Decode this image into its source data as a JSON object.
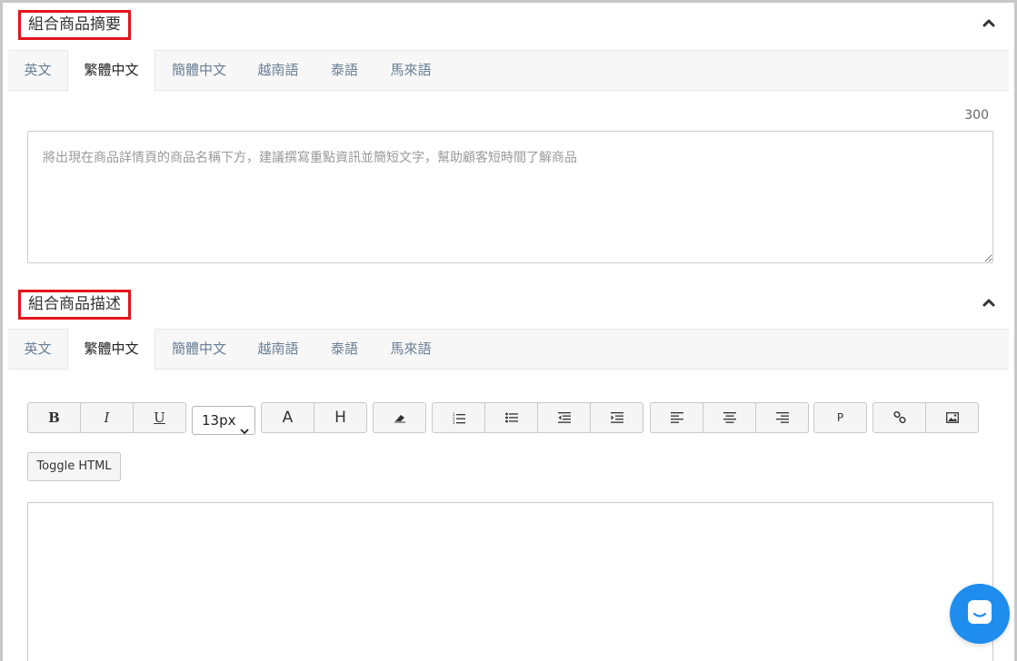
{
  "summary": {
    "title": "組合商品摘要",
    "tabs": [
      {
        "label": "英文"
      },
      {
        "label": "繁體中文"
      },
      {
        "label": "簡體中文"
      },
      {
        "label": "越南語"
      },
      {
        "label": "泰語"
      },
      {
        "label": "馬來語"
      }
    ],
    "active_tab": "繁體中文",
    "char_limit": "300",
    "placeholder": "將出現在商品詳情頁的商品名稱下方，建議撰寫重點資訊並簡短文字，幫助顧客短時間了解商品",
    "value": ""
  },
  "description": {
    "title": "組合商品描述",
    "tabs": [
      {
        "label": "英文"
      },
      {
        "label": "繁體中文"
      },
      {
        "label": "簡體中文"
      },
      {
        "label": "越南語"
      },
      {
        "label": "泰語"
      },
      {
        "label": "馬來語"
      }
    ],
    "active_tab": "繁體中文",
    "toolbar": {
      "bold": "B",
      "italic": "I",
      "underline": "U",
      "font_size": "13px",
      "font_color": "A",
      "highlight": "H",
      "paragraph": "P",
      "toggle_html": "Toggle HTML"
    }
  },
  "colors": {
    "highlight_border": "#e5131c",
    "chat_launcher": "#1f8ded",
    "tab_inactive_text": "#6a7f94"
  },
  "icons": {
    "collapse": "chevron-up-icon",
    "clear_format": "eraser-icon",
    "ordered_list": "ordered-list-icon",
    "unordered_list": "unordered-list-icon",
    "outdent": "outdent-icon",
    "indent": "indent-icon",
    "align_left": "align-left-icon",
    "align_center": "align-center-icon",
    "align_right": "align-right-icon",
    "link": "link-icon",
    "image": "image-icon",
    "chat": "chat-icon"
  }
}
